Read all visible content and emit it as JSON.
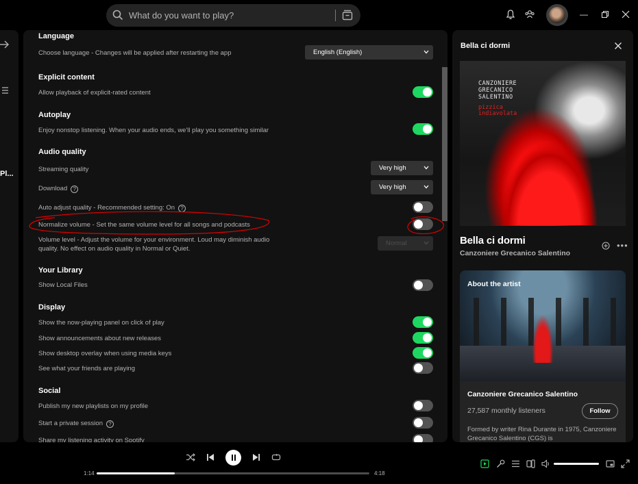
{
  "search": {
    "placeholder": "What do you want to play?"
  },
  "left": {
    "truncated_label": "Pl..."
  },
  "settings": {
    "language": {
      "title": "Language",
      "label": "Choose language - Changes will be applied after restarting the app",
      "value": "English (English)"
    },
    "explicit": {
      "title": "Explicit content",
      "label": "Allow playback of explicit-rated content",
      "on": true
    },
    "autoplay": {
      "title": "Autoplay",
      "label": "Enjoy nonstop listening. When your audio ends, we'll play you something similar",
      "on": true
    },
    "audio_quality": {
      "title": "Audio quality",
      "streaming_label": "Streaming quality",
      "streaming_value": "Very high",
      "download_label": "Download",
      "download_value": "Very high",
      "auto_adjust_label": "Auto adjust quality - Recommended setting: On",
      "auto_adjust_on": false,
      "normalize_label": "Normalize volume - Set the same volume level for all songs and podcasts",
      "normalize_on": false,
      "volume_level_label": "Volume level - Adjust the volume for your environment. Loud may diminish audio quality. No effect on audio quality in Normal or Quiet.",
      "volume_level_value": "Normal"
    },
    "library": {
      "title": "Your Library",
      "local_files_label": "Show Local Files",
      "local_files_on": false
    },
    "display": {
      "title": "Display",
      "items": [
        {
          "label": "Show the now-playing panel on click of play",
          "on": true
        },
        {
          "label": "Show announcements about new releases",
          "on": true
        },
        {
          "label": "Show desktop overlay when using media keys",
          "on": true
        },
        {
          "label": "See what your friends are playing",
          "on": false
        }
      ]
    },
    "social": {
      "title": "Social",
      "items": [
        {
          "label": "Publish my new playlists on my profile",
          "on": false
        },
        {
          "label": "Start a private session",
          "on": false
        },
        {
          "label": "Share my listening activity on Spotify",
          "on": false
        }
      ]
    }
  },
  "now_playing": {
    "panel_title": "Bella ci dormi",
    "song": "Bella ci dormi",
    "artist": "Canzoniere Grecanico Salentino",
    "cover_text": [
      "CANZONIERE",
      "GRECANICO",
      "SALENTINO"
    ],
    "cover_subtitle": [
      "pizzica",
      "indiavolata"
    ],
    "about": {
      "title": "About the artist",
      "name": "Canzoniere Grecanico Salentino",
      "listeners": "27,587 monthly listeners",
      "follow_label": "Follow",
      "bio": "Formed by writer Rina Durante in 1975, Canzoniere Grecanico Salentino (CGS) is"
    }
  },
  "player": {
    "elapsed": "1:14",
    "duration": "4:18",
    "progress": 0.287,
    "volume": 1.0
  },
  "colors": {
    "accent": "#1ed760",
    "annotation": "#e00000"
  }
}
